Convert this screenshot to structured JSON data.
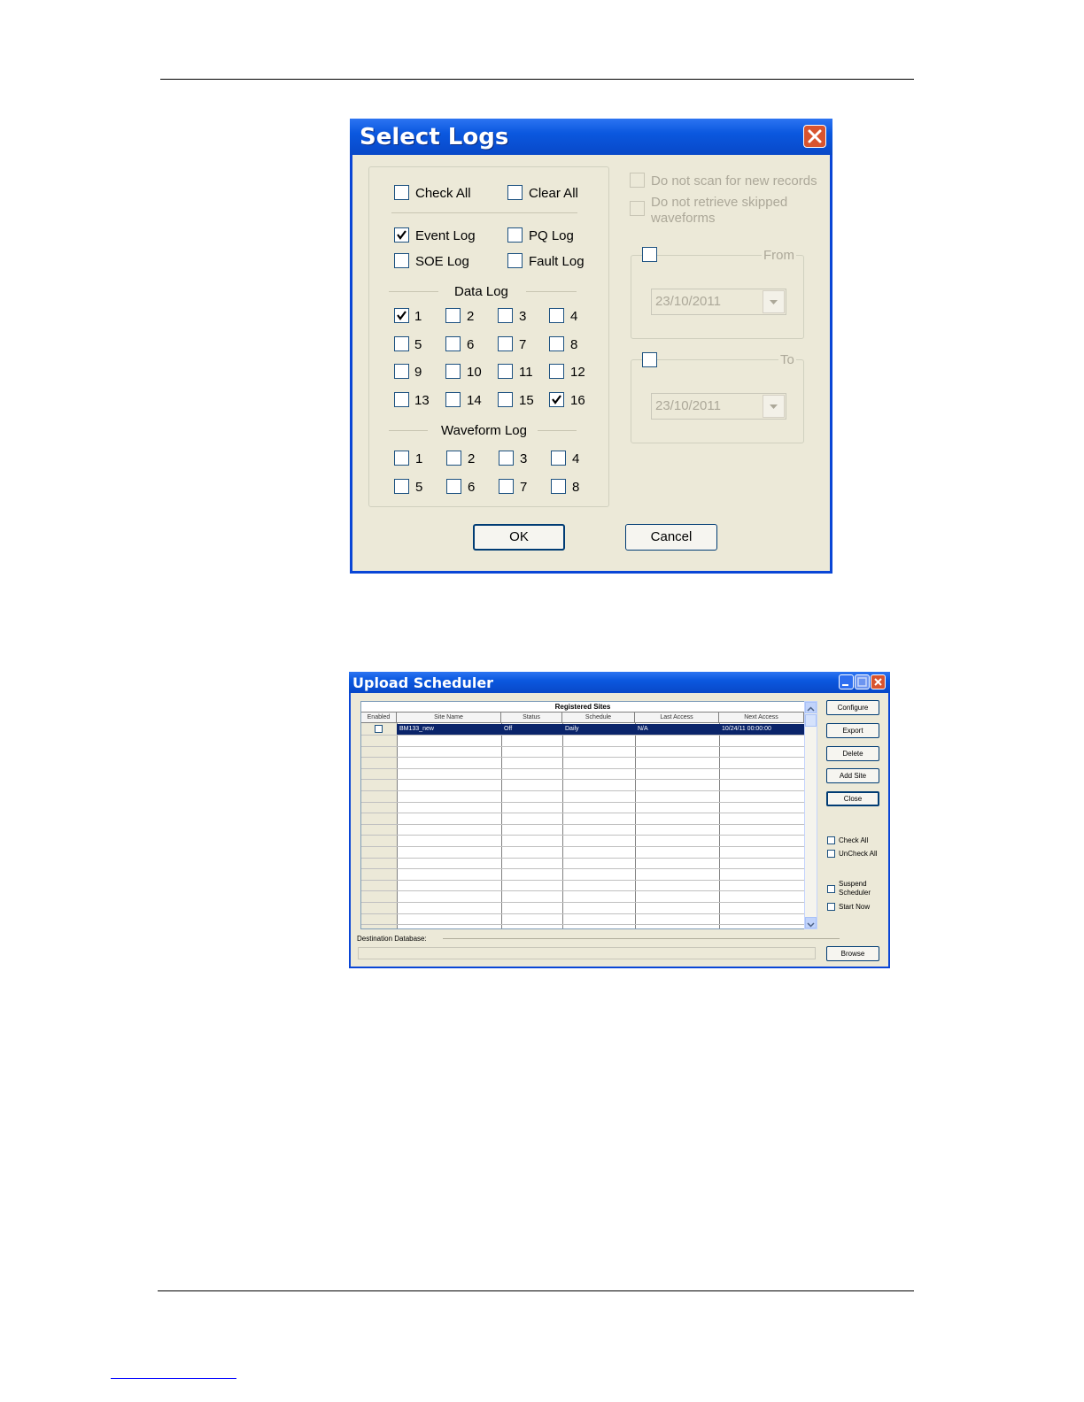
{
  "select_logs": {
    "title": "Select Logs",
    "check_all": "Check All",
    "clear_all": "Clear All",
    "event_log": "Event Log",
    "pq_log": "PQ Log",
    "soe_log": "SOE Log",
    "fault_log": "Fault Log",
    "data_log_header": "Data Log",
    "data_log": [
      {
        "label": "1",
        "checked": true
      },
      {
        "label": "2",
        "checked": false
      },
      {
        "label": "3",
        "checked": false
      },
      {
        "label": "4",
        "checked": false
      },
      {
        "label": "5",
        "checked": false
      },
      {
        "label": "6",
        "checked": false
      },
      {
        "label": "7",
        "checked": false
      },
      {
        "label": "8",
        "checked": false
      },
      {
        "label": "9",
        "checked": false
      },
      {
        "label": "10",
        "checked": false
      },
      {
        "label": "11",
        "checked": false
      },
      {
        "label": "12",
        "checked": false
      },
      {
        "label": "13",
        "checked": false
      },
      {
        "label": "14",
        "checked": false
      },
      {
        "label": "15",
        "checked": false
      },
      {
        "label": "16",
        "checked": true
      }
    ],
    "waveform_log_header": "Waveform Log",
    "waveform_log": [
      "1",
      "2",
      "3",
      "4",
      "5",
      "6",
      "7",
      "8"
    ],
    "no_scan": "Do not scan for new records",
    "no_retrieve_line1": "Do not retrieve skipped",
    "no_retrieve_line2": "waveforms",
    "from_label": "From",
    "from_date": "23/10/2011",
    "to_label": "To",
    "to_date": "23/10/2011",
    "ok": "OK",
    "cancel": "Cancel"
  },
  "upload_scheduler": {
    "title": "Upload Scheduler",
    "grid_caption": "Registered Sites",
    "columns": [
      "Enabled",
      "Site Name",
      "Status",
      "Schedule",
      "Last Access",
      "Next Access"
    ],
    "row": {
      "site_name": "BM133_new",
      "status": "Off",
      "schedule": "Daily",
      "last_access": "N/A",
      "next_access": "10/24/11 00:00:00"
    },
    "buttons": {
      "configure": "Configure",
      "export": "Export",
      "delete": "Delete",
      "add_site": "Add Site",
      "close": "Close",
      "browse": "Browse"
    },
    "check_all": "Check All",
    "uncheck_all": "UnCheck All",
    "suspend_1": "Suspend",
    "suspend_2": "Scheduler",
    "start_now": "Start Now",
    "destination_label": "Destination Database:"
  },
  "colors": {
    "title_bar": "#0b58df",
    "dialog_bg": "#ece9d8",
    "selection": "#0a246a"
  }
}
